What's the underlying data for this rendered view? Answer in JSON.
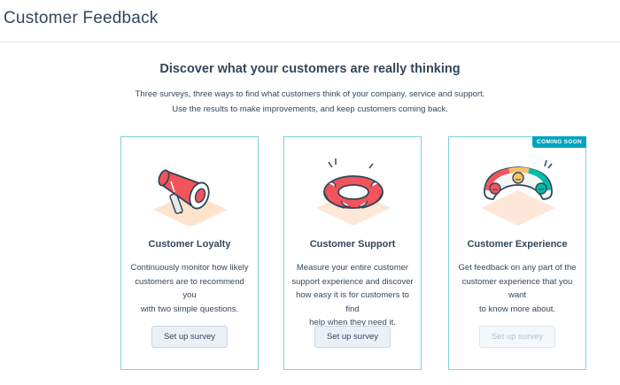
{
  "header": {
    "title": "Customer Feedback"
  },
  "intro": {
    "headline": "Discover what your customers are really thinking",
    "line1": "Three surveys, three ways to find what customers think of your company, service and support.",
    "line2": "Use the results to make improvements, and keep customers coming back."
  },
  "cards": [
    {
      "title": "Customer Loyalty",
      "desc_lines": [
        "Continuously monitor how likely",
        "customers are to recommend you",
        "with two simple questions."
      ],
      "button_label": "Set up survey",
      "icon": "megaphone-icon"
    },
    {
      "title": "Customer Support",
      "desc_lines": [
        "Measure your entire customer",
        "support experience and discover",
        "how easy it is for customers to find",
        "help when they need it."
      ],
      "button_label": "Set up survey",
      "icon": "life-ring-icon"
    },
    {
      "title": "Customer Experience",
      "desc_lines": [
        "Get feedback on any part of the",
        "customer experience that you want",
        "to know more about."
      ],
      "button_label": "Set up survey",
      "badge": "COMING SOON",
      "icon": "rating-gauge-icon",
      "button_disabled": true
    }
  ],
  "colors": {
    "text": "#33475b",
    "card_border": "#7fd1de",
    "badge": "#00a4bd",
    "button_bg": "#eaf0f6",
    "illustration_red": "#f2545b",
    "illustration_peach": "#fce7d8"
  }
}
